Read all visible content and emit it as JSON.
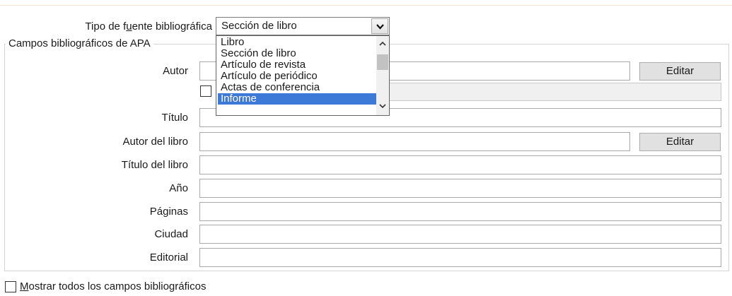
{
  "source_type": {
    "label_pre": "Tipo de f",
    "label_accel": "u",
    "label_post": "ente bibliográfica",
    "value": "Sección de libro",
    "options": [
      "Libro",
      "Sección de libro",
      "Artículo de revista",
      "Artículo de periódico",
      "Actas de conferencia",
      "Informe"
    ],
    "selected_option": "Informe"
  },
  "group_title": "Campos bibliográficos de APA",
  "fields": {
    "autor": "Autor",
    "titulo": "Título",
    "autor_libro": "Autor del libro",
    "titulo_libro": "Título del libro",
    "anio": "Año",
    "paginas": "Páginas",
    "ciudad": "Ciudad",
    "editorial": "Editorial"
  },
  "buttons": {
    "editar_1": "Editar",
    "editar_2": "Editar"
  },
  "footer": {
    "accel": "M",
    "rest": "ostrar todos los campos bibliográficos",
    "checked": false
  },
  "colors": {
    "selection": "#3d79d6",
    "disabled_field": "#f0f0f0"
  },
  "icons": {
    "combo_arrow": "chevron-down-icon",
    "scroll_up": "chevron-up-icon",
    "scroll_down": "chevron-down-icon"
  }
}
